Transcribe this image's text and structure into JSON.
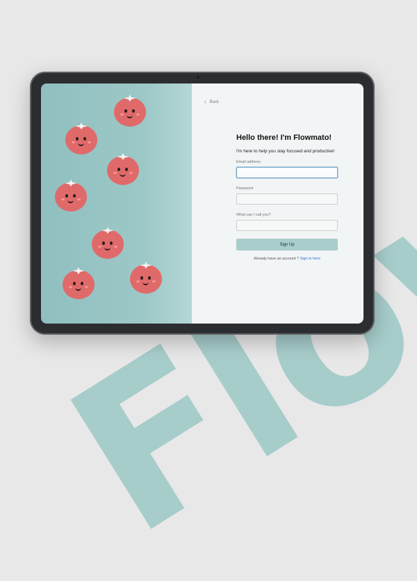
{
  "background": {
    "wordmark": "Flowmato",
    "colors": {
      "page": "#e8e8e8",
      "wordmark": "#a7cdcb"
    }
  },
  "left_panel": {
    "tomatoes": [
      {
        "id": "t1"
      },
      {
        "id": "t2"
      },
      {
        "id": "t3"
      },
      {
        "id": "t4"
      },
      {
        "id": "t5"
      },
      {
        "id": "t6"
      },
      {
        "id": "t7"
      }
    ]
  },
  "form": {
    "back_label": "Back",
    "title": "Hello there! I'm Flowmato!",
    "subtitle": "I'm here to help you stay focused and productive!",
    "email": {
      "label": "Email address",
      "value": "",
      "placeholder": ""
    },
    "password": {
      "label": "Password",
      "value": "",
      "placeholder": ""
    },
    "nickname": {
      "label": "What can I call you?",
      "value": "",
      "placeholder": ""
    },
    "submit_label": "Sign Up",
    "signin_prompt": "Already have an account ?",
    "signin_link": "Sign in here"
  },
  "colors": {
    "accent": "#a9cdcb",
    "link": "#2f6fd0",
    "tomato": "#e06a6a",
    "panel": "#8fbfbf"
  }
}
